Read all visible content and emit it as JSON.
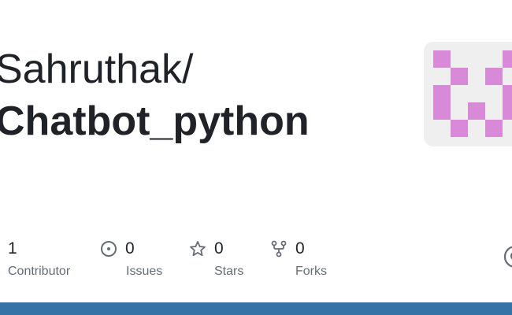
{
  "repo": {
    "owner": "Sahruthak/",
    "name": "Chatbot_python"
  },
  "stats": [
    {
      "icon": "people-icon",
      "value": "1",
      "label": "Contributor"
    },
    {
      "icon": "issue-icon",
      "value": "0",
      "label": "Issues"
    },
    {
      "icon": "star-icon",
      "value": "0",
      "label": "Stars"
    },
    {
      "icon": "fork-icon",
      "value": "0",
      "label": "Forks"
    }
  ],
  "colors": {
    "avatar_fg": "#d88ad8",
    "avatar_bg": "#efefef",
    "bottom_bar": "#3572a5",
    "icon": "#656d76",
    "title": "#1f2328"
  }
}
